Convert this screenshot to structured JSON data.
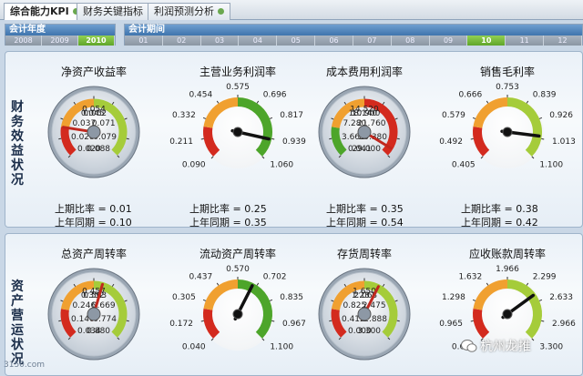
{
  "tabs": [
    {
      "label": "综合能力KPI",
      "active": true
    },
    {
      "label": "财务关键指标",
      "active": false
    },
    {
      "label": "利润预测分析",
      "active": false
    }
  ],
  "fiscal_year": {
    "title": "会计年度",
    "years": [
      "2008",
      "2009",
      "2010"
    ],
    "selected": "2010"
  },
  "fiscal_period": {
    "title": "会计期间",
    "periods": [
      "01",
      "02",
      "03",
      "04",
      "05",
      "06",
      "07",
      "08",
      "09",
      "10",
      "11",
      "12"
    ],
    "selected": "10"
  },
  "sections": [
    {
      "label": "财务效益状况"
    },
    {
      "label": "资产营运状况"
    }
  ],
  "gauges": [
    {
      "title": "净资产收益率",
      "ticks": [
        "0.020",
        "0.028",
        "0.037",
        "0.045",
        "0.054",
        "0.062",
        "0.071",
        "0.079",
        "0.088"
      ],
      "needle": 0.2,
      "stats": [
        "上期比率 = 0.01",
        "上年同期 = 0.10"
      ],
      "colors": [
        "#d32a1e",
        "#f0a030",
        "#a5cc3a"
      ],
      "style": "silver"
    },
    {
      "title": "主营业务利润率",
      "ticks": [
        "0.090",
        "0.211",
        "0.332",
        "0.454",
        "0.575",
        "0.696",
        "0.817",
        "0.939",
        "1.060"
      ],
      "needle": 0.88,
      "stats": [
        "上期比率 = 0.25",
        "上年同期 = 0.35"
      ],
      "colors": [
        "#d32a1e",
        "#f0a030",
        "#4da52a"
      ],
      "style": "white"
    },
    {
      "title": "成本费用利润率",
      "ticks": [
        "0.041",
        "3.661",
        "7.280",
        "10.900",
        "14.520",
        "18.140",
        "21.760",
        "25.380",
        "29.000"
      ],
      "needle": 0.95,
      "stats": [
        "上期比率 = 0.35",
        "上年同期 = 0.54"
      ],
      "colors": [
        "#4da52a",
        "#f0a030",
        "#d32a1e"
      ],
      "style": "silver"
    },
    {
      "title": "销售毛利率",
      "ticks": [
        "0.405",
        "0.492",
        "0.579",
        "0.666",
        "0.753",
        "0.839",
        "0.926",
        "1.013",
        "1.100"
      ],
      "needle": 0.86,
      "stats": [
        "上期比率 = 0.38",
        "上年同期 = 0.42"
      ],
      "colors": [
        "#d32a1e",
        "#f0a030",
        "#a5cc3a"
      ],
      "style": "white"
    },
    {
      "title": "总资产周转率",
      "ticks": [
        "0.034",
        "0.140",
        "0.246",
        "0.352",
        "0.457",
        "0.563",
        "0.669",
        "0.774",
        "0.880"
      ],
      "needle": 0.56,
      "stats": [],
      "colors": [
        "#d32a1e",
        "#f0a030",
        "#a5cc3a"
      ],
      "style": "silver"
    },
    {
      "title": "流动资产周转率",
      "ticks": [
        "0.040",
        "0.172",
        "0.305",
        "0.437",
        "0.570",
        "0.702",
        "0.835",
        "0.967",
        "1.100"
      ],
      "needle": 0.6,
      "stats": [],
      "colors": [
        "#d32a1e",
        "#f0a030",
        "#4da52a"
      ],
      "style": "white"
    },
    {
      "title": "存货周转率",
      "ticks": [
        "0.000",
        "0.412",
        "0.825",
        "1.237",
        "1.650",
        "2.063",
        "2.475",
        "2.888",
        "3.300"
      ],
      "needle": 0.6,
      "stats": [],
      "colors": [
        "#d32a1e",
        "#f0a030",
        "#a5cc3a"
      ],
      "style": "silver"
    },
    {
      "title": "应收账款周转率",
      "ticks": [
        "0.631",
        "0.965",
        "1.298",
        "1.632",
        "1.966",
        "2.299",
        "2.633",
        "2.966",
        "3.300"
      ],
      "needle": 0.7,
      "stats": [],
      "colors": [
        "#d32a1e",
        "#f0a030",
        "#a5cc3a"
      ],
      "style": "white"
    }
  ],
  "watermark": "杭州龙推",
  "corner_text": "3150.com"
}
